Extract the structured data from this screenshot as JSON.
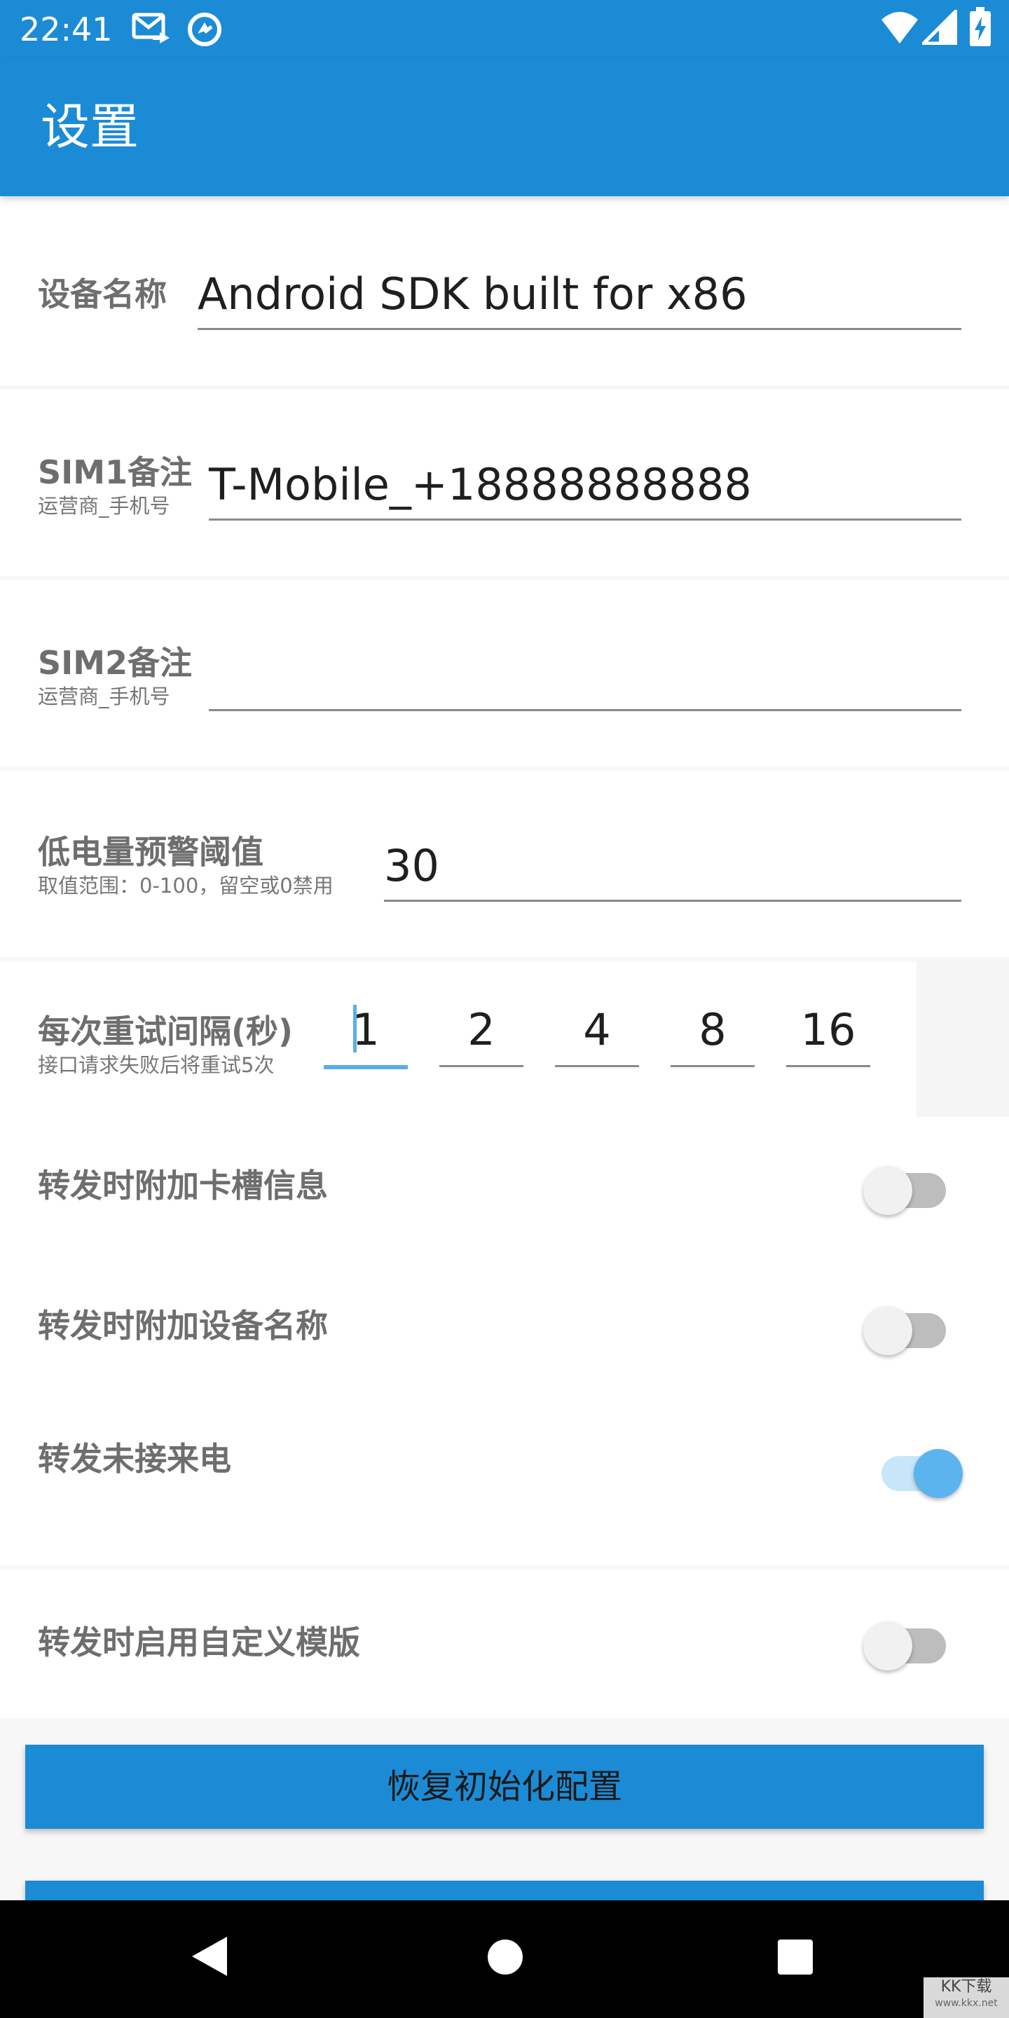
{
  "status_bar": {
    "time": "22:41",
    "icons": [
      "mail-forward-icon",
      "sync-icon",
      "wifi-icon",
      "signal-icon",
      "battery-charging-icon"
    ]
  },
  "app_bar": {
    "title": "设置"
  },
  "settings": {
    "device_name": {
      "label": "设备名称",
      "value": "Android SDK built for x86"
    },
    "sim1": {
      "label": "SIM1备注",
      "hint": "运营商_手机号",
      "value": "T-Mobile_+18888888888"
    },
    "sim2": {
      "label": "SIM2备注",
      "hint": "运营商_手机号",
      "value": ""
    },
    "battery": {
      "label": "低电量预警阈值",
      "hint": "取值范围：0-100，留空或0禁用",
      "value": "30"
    },
    "retry": {
      "label": "每次重试间隔(秒)",
      "hint": "接口请求失败后将重试5次",
      "values": [
        "1",
        "2",
        "4",
        "8",
        "16"
      ]
    }
  },
  "switches": [
    {
      "label": "转发时附加卡槽信息",
      "on": false
    },
    {
      "label": "转发时附加设备名称",
      "on": false
    },
    {
      "label": "转发未接来电",
      "on": true
    },
    {
      "label": "转发时启用自定义模版",
      "on": false
    }
  ],
  "buttons": {
    "reset": "恢复初始化配置"
  },
  "nav_bar": {
    "icons": [
      "back-icon",
      "home-icon",
      "recents-icon"
    ]
  },
  "watermark": {
    "text": "KK下载",
    "sub": "www.kkx.net"
  },
  "colors": {
    "primary": "#1c8bd6",
    "accent": "#5cb4ef",
    "switch_track_on": "#c8e6fa"
  }
}
